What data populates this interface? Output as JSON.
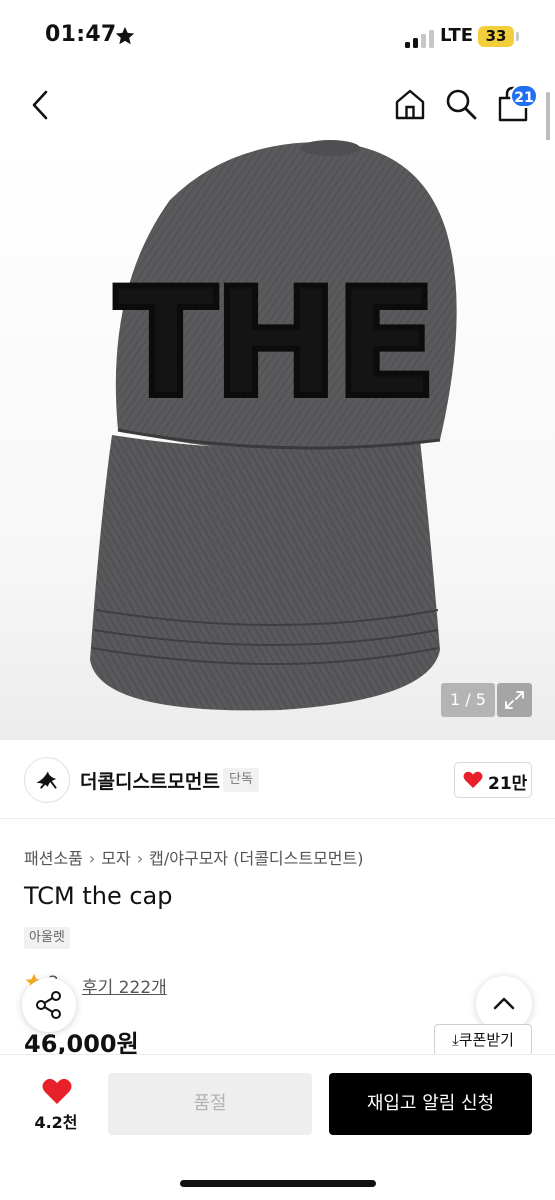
{
  "status_bar": {
    "time": "01:47",
    "network": "LTE",
    "battery": "33"
  },
  "nav": {
    "cart_badge": "21"
  },
  "gallery": {
    "counter": "1 / 5",
    "cap_text": "THE"
  },
  "brand": {
    "name": "더콜디스트모먼트",
    "badge": "단독",
    "likes": "21만"
  },
  "breadcrumb": [
    "패션소품",
    "모자",
    "캡/야구모자 (더콜디스트모먼트)"
  ],
  "product": {
    "title": "TCM the cap",
    "tag": "아울렛",
    "rating_partial": "3",
    "review_link": "후기 222개",
    "price": "46,000원"
  },
  "coupon_label": "쿠폰받기",
  "bottom_bar": {
    "wish_count": "4.2천",
    "soldout_label": "품절",
    "restock_label": "재입고 알림 신청"
  },
  "colors": {
    "accent": "#1f6ff2",
    "heart": "#e8202a",
    "cta": "#000000"
  }
}
